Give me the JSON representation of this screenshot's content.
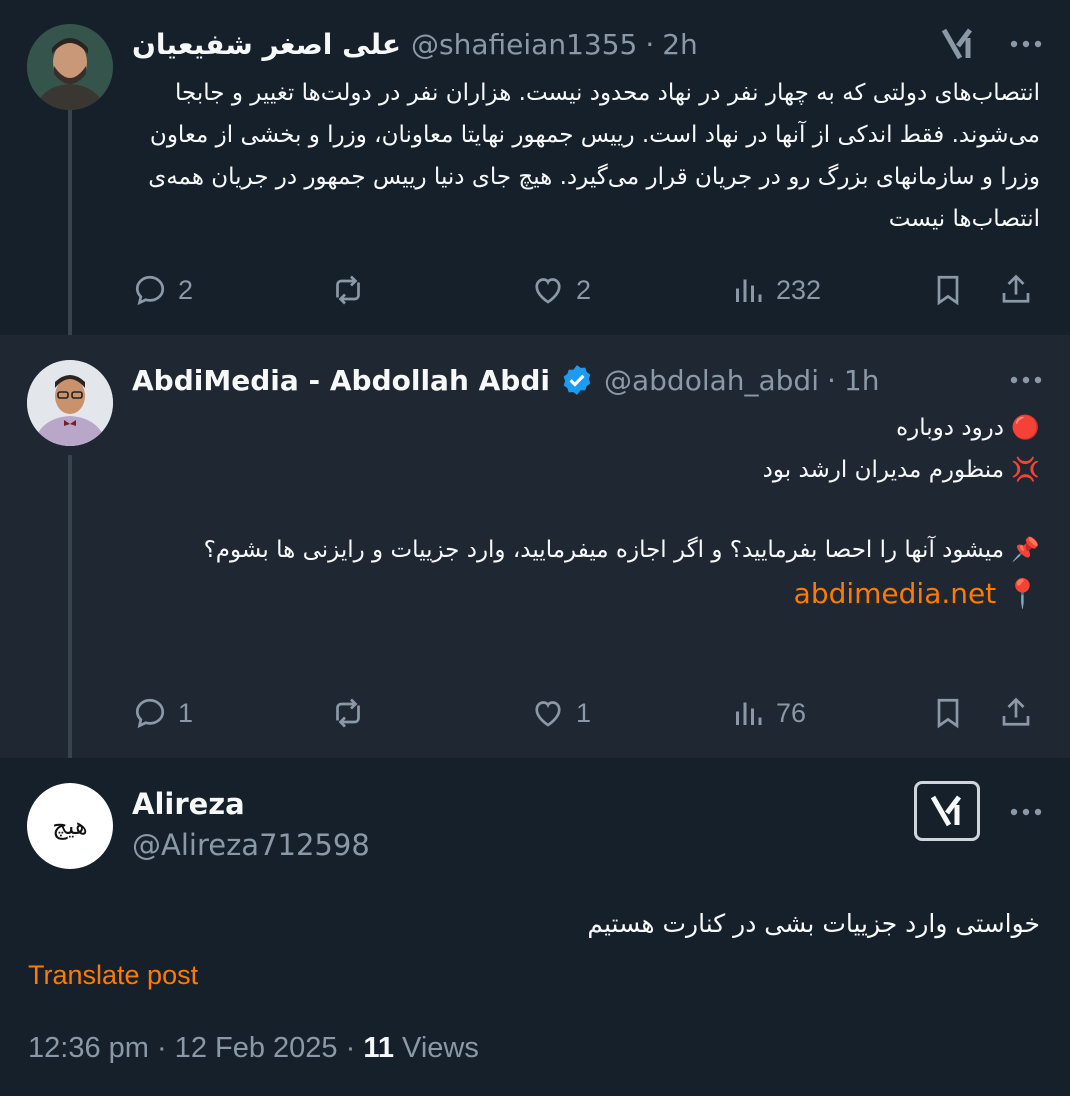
{
  "tweets": [
    {
      "name": "علی اصغر شفیعیان",
      "handle": "@shafieian1355",
      "sep": "·",
      "time": "2h",
      "text": "انتصاب‌های دولتی که به چهار نفر در نهاد محدود نیست. هزاران نفر در دولت‌ها تغییر و جابجا می‌شوند. فقط اندکی از آنها در نهاد است. رییس جمهور نهایتا معاونان، وزرا و بخشی از معاون وزرا و سازمانهای بزرگ رو در جریان قرار می‌گیرد. هیچ جای دنیا رییس جمهور در جریان همه‌ی انتصاب‌ها نیست",
      "replies": "2",
      "reposts": "",
      "likes": "2",
      "views": "232",
      "avatar_icon": "man-avatar-icon"
    },
    {
      "name": "AbdiMedia - Abdollah Abdi",
      "handle": "@abdolah_abdi",
      "sep": "·",
      "time": "1h",
      "line1": "درود دوباره",
      "line1_emoji": "🔴",
      "line2": "منظورم مدیران ارشد بود",
      "line2_emoji": "💢",
      "line3": "میشود آنها را احصا بفرمایید؟ و اگر اجازه میفرمایید، وارد جزییات و رایزنی ها بشوم؟",
      "line3_emoji": "📌",
      "link": "abdimedia.net",
      "link_emoji": "📍",
      "replies": "1",
      "reposts": "",
      "likes": "1",
      "views": "76",
      "avatar_icon": "man-avatar-icon"
    },
    {
      "name": "Alireza",
      "handle": "@Alireza712598",
      "text": "خواستی وارد جزییات بشی در کنارت هستیم",
      "avatar_text": "هیچ",
      "translate": "Translate post",
      "timestamp": "12:36 pm · 12 Feb 2025 · ",
      "views_count": "11",
      "views_label": " Views"
    }
  ],
  "colors": {
    "background": "#15202b",
    "highlight_background": "#1e2732",
    "text": "#f7f9f9",
    "muted": "#8b98a5",
    "link": "#ff7a00",
    "verified": "#1d9bf0"
  }
}
